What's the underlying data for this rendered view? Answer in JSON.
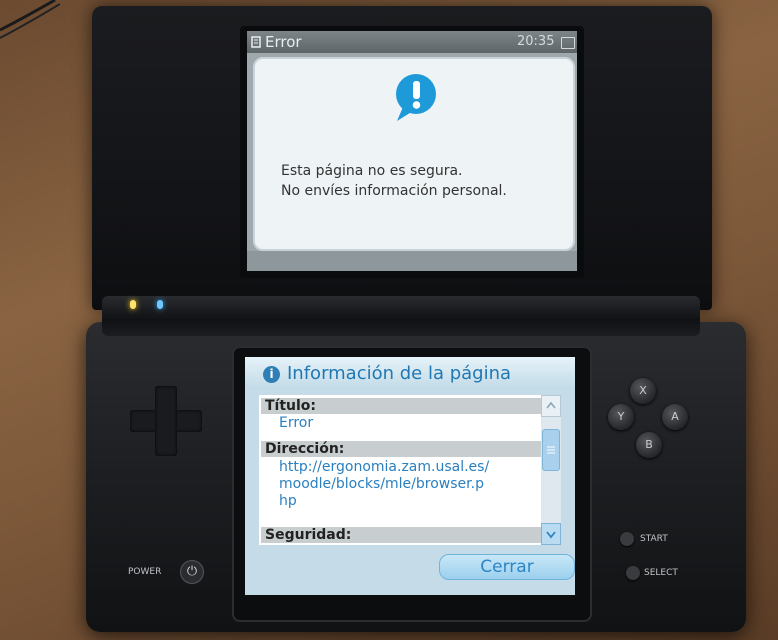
{
  "top_screen": {
    "title": "Error",
    "time": "20:35",
    "message_line1": "Esta página no es segura.",
    "message_line2": "No envíes información personal.",
    "alert_icon": "exclamation-speech-bubble-icon"
  },
  "bottom_screen": {
    "title": "Información de la página",
    "info_icon": "i",
    "sections": [
      {
        "label": "Título:",
        "lines": [
          "Error"
        ]
      },
      {
        "label": "Dirección:",
        "lines": [
          "http://ergonomia.zam.usal.es/",
          "moodle/blocks/mle/browser.p",
          "hp"
        ]
      },
      {
        "label": "Seguridad:",
        "lines": []
      }
    ],
    "close_label": "Cerrar"
  },
  "buttons": {
    "x": "X",
    "y": "Y",
    "a": "A",
    "b": "B",
    "start": "START",
    "select": "SELECT",
    "power": "POWER",
    "power_symbol": "⏻"
  },
  "colors": {
    "accent_blue": "#1f78b4",
    "link_blue": "#2a7fc0",
    "alert_blue": "#1e9ad8",
    "led_yellow": "#ffe36b",
    "led_blue": "#6fc9ff"
  }
}
